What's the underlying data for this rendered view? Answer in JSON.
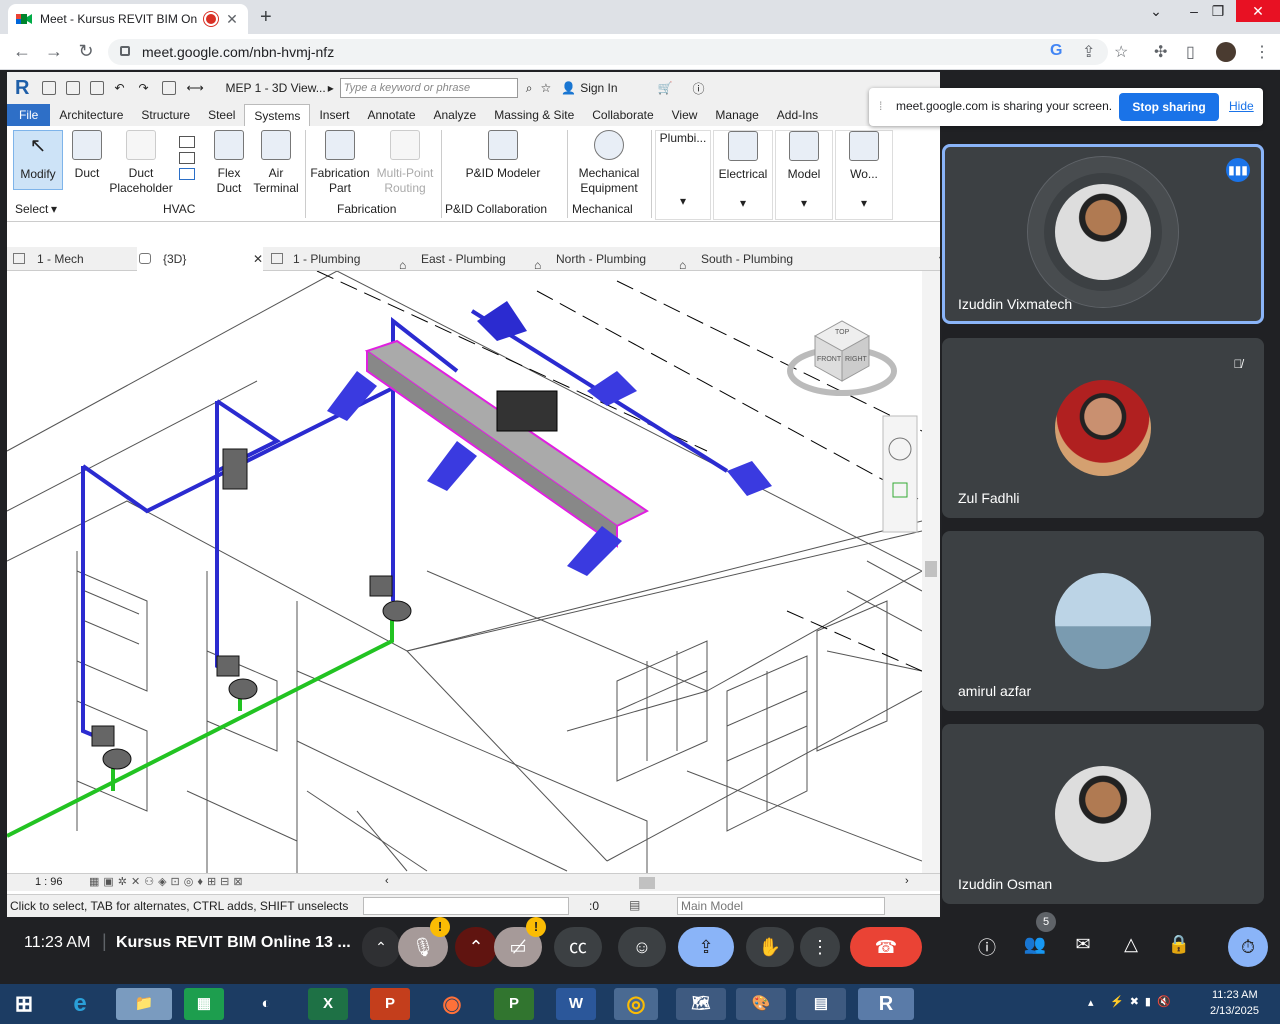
{
  "browser": {
    "tab_title": "Meet - Kursus REVIT BIM On",
    "url": "meet.google.com/nbn-hvmj-nfz"
  },
  "revit": {
    "view_title": "MEP 1 - 3D View...",
    "search_placeholder": "Type a keyword or phrase",
    "sign_in": "Sign In",
    "ribbon_tabs": [
      "File",
      "Architecture",
      "Structure",
      "Steel",
      "Systems",
      "Insert",
      "Annotate",
      "Analyze",
      "Massing & Site",
      "Collaborate",
      "View",
      "Manage",
      "Add-Ins"
    ],
    "active_tab": "Systems",
    "buttons": {
      "modify": "Modify",
      "duct": "Duct",
      "duct_placeholder_1": "Duct",
      "duct_placeholder_2": "Placeholder",
      "flex_duct_1": "Flex",
      "flex_duct_2": "Duct",
      "air_terminal_1": "Air",
      "air_terminal_2": "Terminal",
      "fabrication_part_1": "Fabrication",
      "fabrication_part_2": "Part",
      "multipoint_1": "Multi-Point",
      "multipoint_2": "Routing",
      "pid_modeler": "P&ID Modeler",
      "mech_equipment_1": "Mechanical",
      "mech_equipment_2": "Equipment",
      "plumbing": "Plumbi...",
      "electrical": "Electrical",
      "model": "Model",
      "work": "Wo..."
    },
    "panels": {
      "select": "Select",
      "hvac": "HVAC",
      "fabrication": "Fabrication",
      "pid": "P&ID Collaboration",
      "mechanical": "Mechanical"
    },
    "view_tabs": [
      "1 - Mech",
      "{3D}",
      "1 - Plumbing",
      "East - Plumbing",
      "North - Plumbing",
      "South - Plumbing"
    ],
    "scale": "1 : 96",
    "status_text": "Click to select, TAB for alternates, CTRL adds, SHIFT unselects",
    "filter_count": ":0",
    "model_select": "Main Model",
    "viewcube": {
      "top": "TOP",
      "front": "FRONT",
      "right": "RIGHT"
    }
  },
  "share_banner": {
    "message": "meet.google.com is sharing your screen.",
    "stop": "Stop sharing",
    "hide": "Hide"
  },
  "participants": [
    {
      "name": "Izuddin Vixmatech",
      "speaking": true
    },
    {
      "name": "Zul Fadhli",
      "muted": true
    },
    {
      "name": "amirul azfar"
    },
    {
      "name": "Izuddin Osman"
    }
  ],
  "meet_bar": {
    "time": "11:23 AM",
    "meeting_title": "Kursus REVIT BIM Online 13 ...",
    "people_count": "5"
  },
  "taskbar": {
    "time": "11:23 AM",
    "date": "2/13/2025"
  },
  "colors": {
    "duct_blue": "#2b2bd0",
    "pipe_green": "#22c322",
    "selected_magenta": "#e020e0",
    "meet_blue": "#1a73e8",
    "end_call_red": "#ea4335"
  }
}
